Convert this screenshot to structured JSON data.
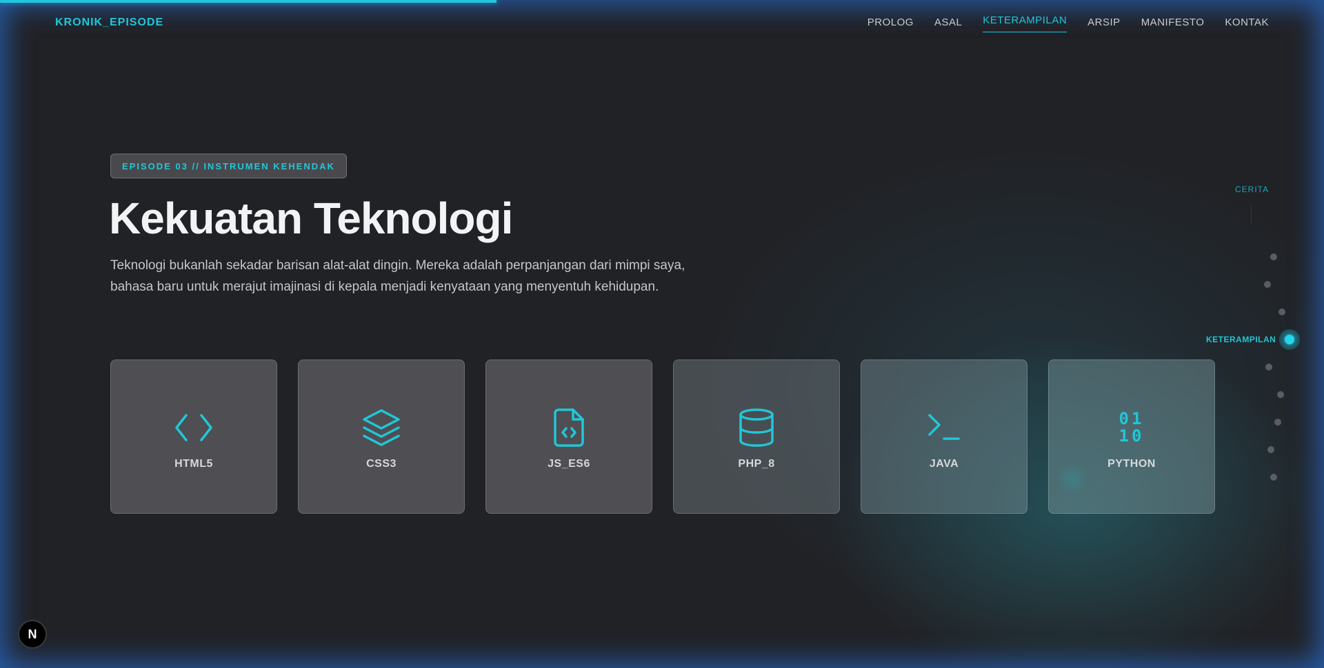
{
  "header": {
    "logo": "KRONIK_EPISODE",
    "nav": [
      "PROLOG",
      "ASAL",
      "KETERAMPILAN",
      "ARSIP",
      "MANIFESTO",
      "KONTAK"
    ],
    "active_nav": "KETERAMPILAN"
  },
  "hero": {
    "badge": "EPISODE 03 // INSTRUMEN KEHENDAK",
    "title": "Kekuatan Teknologi",
    "description": "Teknologi bukanlah sekadar barisan alat-alat dingin. Mereka adalah perpanjangan dari mimpi saya, bahasa baru untuk merajut imajinasi di kepala menjadi kenyataan yang menyentuh kehidupan."
  },
  "skills": [
    {
      "label": "HTML5",
      "icon": "code-brackets-icon"
    },
    {
      "label": "CSS3",
      "icon": "layers-icon"
    },
    {
      "label": "JS_ES6",
      "icon": "file-code-icon"
    },
    {
      "label": "PHP_8",
      "icon": "database-icon"
    },
    {
      "label": "JAVA",
      "icon": "terminal-icon"
    },
    {
      "label": "PYTHON",
      "icon": "binary-icon",
      "binary_top": "01",
      "binary_bottom": "10"
    }
  ],
  "side_nav": {
    "top_label": "CERITA",
    "active_label": "KETERAMPILAN"
  },
  "dev_badge": "N",
  "colors": {
    "accent": "#22c6d8",
    "background": "#212226",
    "frame_glow": "#2a6ed2"
  }
}
